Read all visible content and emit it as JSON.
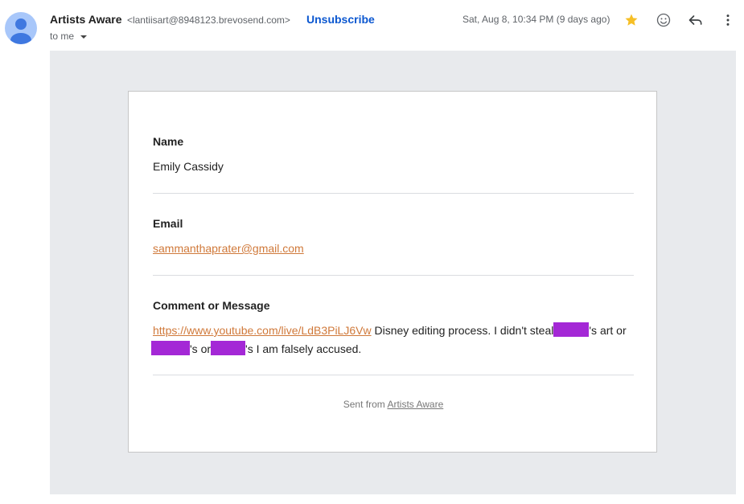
{
  "header": {
    "sender_name": "Artists Aware",
    "sender_email": "<lantiisart@8948123.brevosend.com>",
    "unsubscribe": "Unsubscribe",
    "recipient": "to me",
    "date": "Sat, Aug 8, 10:34 PM (9 days ago)"
  },
  "icons": {
    "avatar": "person-icon",
    "star": "star-icon",
    "emoji": "emoji-icon",
    "reply": "reply-icon",
    "more": "more-vert-icon"
  },
  "colors": {
    "star": "#f6bf26",
    "link_accent": "#d0793a",
    "unsubscribe": "#0b57d0",
    "redaction": "#a428d6"
  },
  "message": {
    "name_label": "Name",
    "name_value": "Emily Cassidy",
    "email_label": "Email",
    "email_value": "sammanthaprater@gmail.com",
    "comment_label": "Comment or Message",
    "comment_link": "https://www.youtube.com/live/LdB3PiLJ6Vw",
    "comment_text_1": " Disney editing process. I didn't steal",
    "comment_text_2": "'s art or",
    "comment_text_3": "'s or",
    "comment_text_4": "'s I am falsely accused.",
    "footer_prefix": "Sent from ",
    "footer_link": "Artists Aware"
  }
}
